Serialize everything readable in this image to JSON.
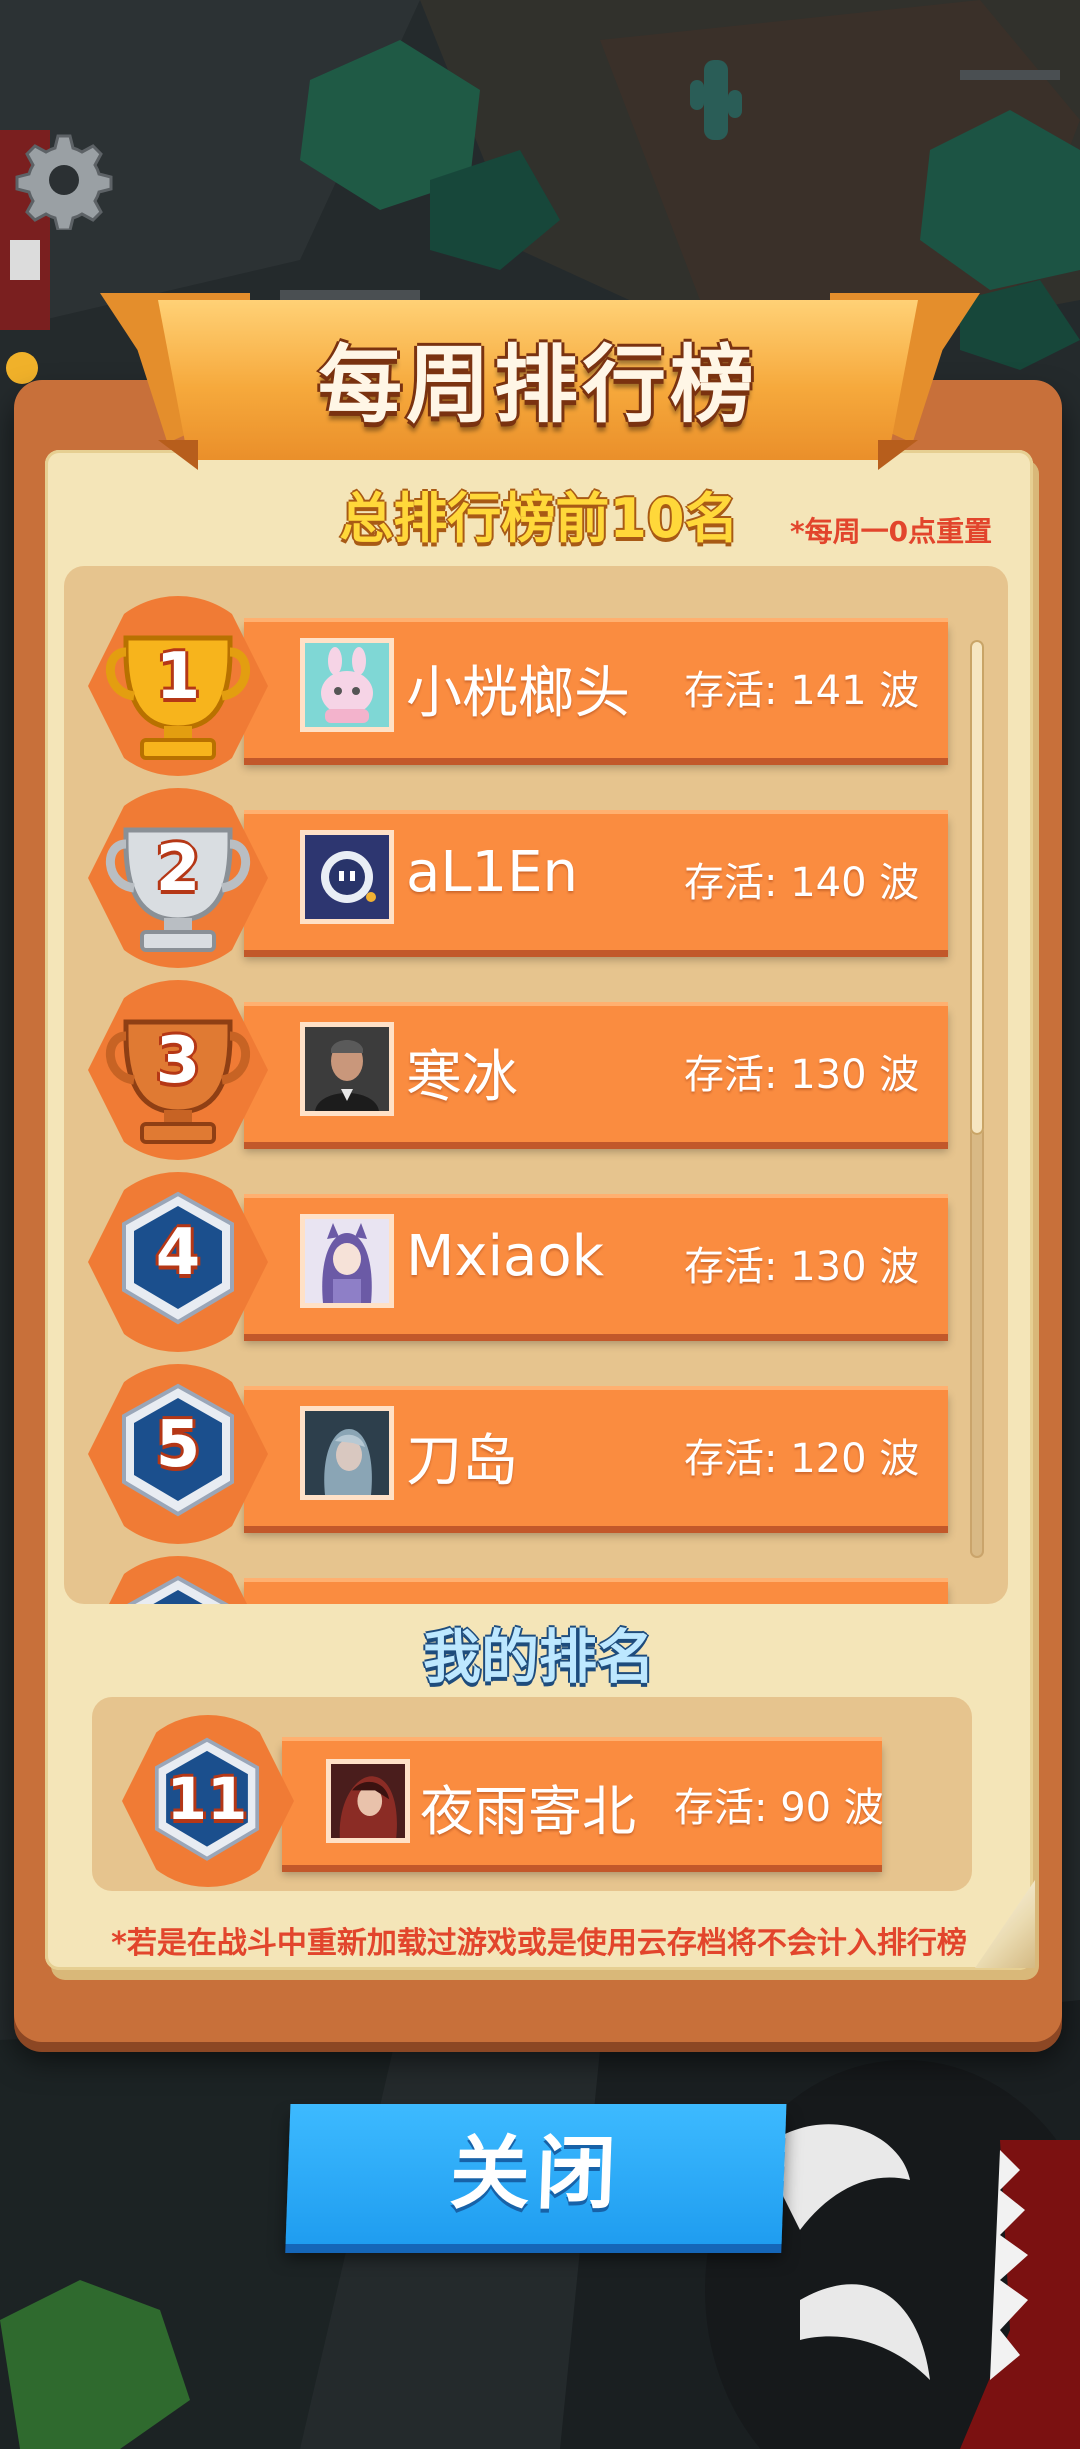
{
  "header": {
    "title": "每周排行榜",
    "subtitle": "总排行榜前10名",
    "reset_note": "*每周一0点重置"
  },
  "leaderboard": [
    {
      "rank": "1",
      "name": "小桄榔头",
      "survive": "存活: 141 波",
      "badge": "gold-trophy-icon"
    },
    {
      "rank": "2",
      "name": "aL1En",
      "survive": "存活: 140 波",
      "badge": "silver-trophy-icon"
    },
    {
      "rank": "3",
      "name": "寒冰",
      "survive": "存活: 130 波",
      "badge": "bronze-trophy-icon"
    },
    {
      "rank": "4",
      "name": "Mxiaok",
      "survive": "存活: 130 波",
      "badge": "hexagon-badge-icon"
    },
    {
      "rank": "5",
      "name": "刀岛",
      "survive": "存活: 120 波",
      "badge": "hexagon-badge-icon"
    }
  ],
  "my_rank": {
    "title": "我的排名",
    "rank": "11",
    "name": "夜雨寄北",
    "survive": "存活: 90 波"
  },
  "warning": "*若是在战斗中重新加载过游戏或是使用云存档将不会计入排行榜",
  "close_label": "关闭",
  "colors": {
    "row_orange": "#fa8c40",
    "paper": "#f4e5b8",
    "frame": "#c8703a",
    "close_blue": "#2aaaf8",
    "subtitle_yellow": "#ffd83a",
    "note_red": "#e2452c"
  }
}
